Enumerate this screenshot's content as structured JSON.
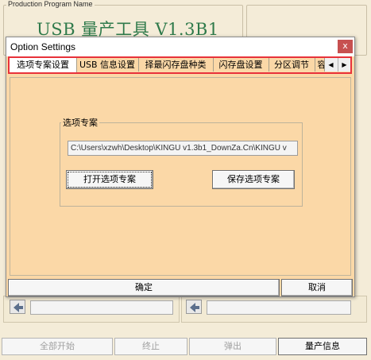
{
  "background": {
    "group_title": "Production Program Name",
    "app_title": "USB 量产工具 V1.3B1"
  },
  "dialog": {
    "title": "Option Settings",
    "close_label": "x",
    "tabs": [
      {
        "label": "选项专案设置",
        "active": true
      },
      {
        "label": "USB 信息设置",
        "active": false
      },
      {
        "label": "择最闪存盘种类",
        "active": false
      },
      {
        "label": "闪存盘设置",
        "active": false
      },
      {
        "label": "分区调节",
        "active": false
      },
      {
        "label": "容",
        "active": false
      }
    ],
    "scroll_left": "◀",
    "scroll_right": "▶",
    "group_title": "选项专案",
    "path_value": "C:\\Users\\xzwh\\Desktop\\KINGU v1.3b1_DownZa.Cn\\KINGU v",
    "open_button": "打开选项专案",
    "save_button": "保存选项专案",
    "ok_button": "确定",
    "cancel_button": "取消"
  },
  "bottom_bar": {
    "start_all": "全部开始",
    "stop": "终止",
    "eject": "弹出",
    "info": "量产信息"
  },
  "colors": {
    "dialog_bg": "#fbd8a7",
    "highlight_border": "#e8323a",
    "title_green": "#2f7a4b",
    "close_red": "#c75050"
  }
}
